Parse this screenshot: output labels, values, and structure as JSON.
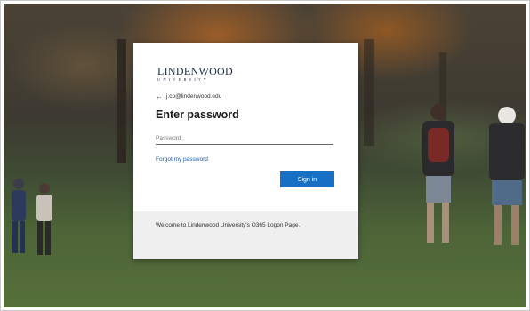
{
  "brand": {
    "name": "LINDENWOOD",
    "sub": "UNIVERSITY"
  },
  "signin_card": {
    "back_email": "j.co@lindenwood.edu",
    "heading": "Enter password",
    "password_placeholder": "Password",
    "forgot_link": "Forgot my password",
    "signin_button": "Sign in",
    "welcome_text": "Welcome to Lindenwood University's O365 Logon Page."
  },
  "colors": {
    "accent": "#1770c3",
    "link": "#1a5aa6",
    "footer_bg": "#efefef"
  },
  "icons": {
    "back": "left-arrow-icon"
  }
}
